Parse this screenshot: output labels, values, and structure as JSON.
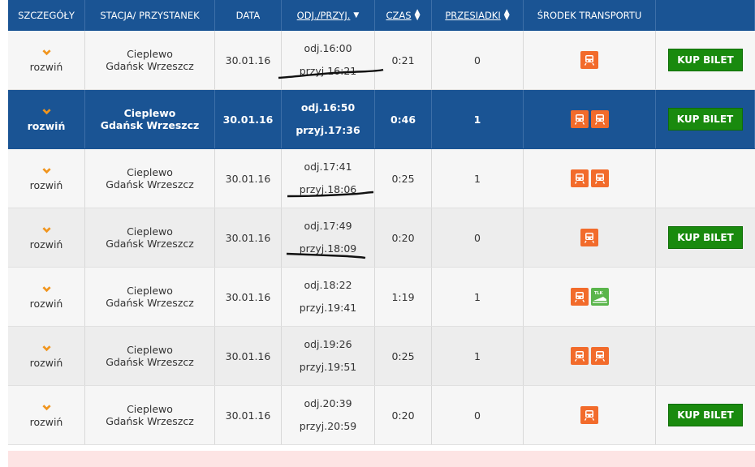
{
  "headers": {
    "details": "SZCZEGÓŁY",
    "station": "STACJA/ PRZYSTANEK",
    "date": "DATA",
    "times": "ODJ./PRZYJ.",
    "duration": "CZAS",
    "transfers": "PRZESIADKI",
    "transport": "ŚRODEK TRANSPORTU"
  },
  "expand_label": "rozwiń",
  "buy_label": "KUP BILET",
  "colors": {
    "header_bg": "#1a5494",
    "accent": "#f0951e",
    "buy_bg": "#198a0e",
    "reg_icon": "#f26b2b",
    "tlk_icon": "#5ab54b"
  },
  "rows": [
    {
      "from": "Cieplewo",
      "to": "Gdańsk Wrzeszcz",
      "date": "30.01.16",
      "dep": "odj.16:00",
      "arr": "przyj.16:21",
      "duration": "0:21",
      "transfers": "0",
      "transport": [
        "reg-icon"
      ],
      "buy": true,
      "selected": false
    },
    {
      "from": "Cieplewo",
      "to": "Gdańsk Wrzeszcz",
      "date": "30.01.16",
      "dep": "odj.16:50",
      "arr": "przyj.17:36",
      "duration": "0:46",
      "transfers": "1",
      "transport": [
        "reg-icon",
        "reg-icon"
      ],
      "buy": true,
      "selected": true
    },
    {
      "from": "Cieplewo",
      "to": "Gdańsk Wrzeszcz",
      "date": "30.01.16",
      "dep": "odj.17:41",
      "arr": "przyj.18:06",
      "duration": "0:25",
      "transfers": "1",
      "transport": [
        "skm-icon",
        "skm-icon"
      ],
      "buy": false,
      "selected": false
    },
    {
      "from": "Cieplewo",
      "to": "Gdańsk Wrzeszcz",
      "date": "30.01.16",
      "dep": "odj.17:49",
      "arr": "przyj.18:09",
      "duration": "0:20",
      "transfers": "0",
      "transport": [
        "reg-icon"
      ],
      "buy": true,
      "selected": false
    },
    {
      "from": "Cieplewo",
      "to": "Gdańsk Wrzeszcz",
      "date": "30.01.16",
      "dep": "odj.18:22",
      "arr": "przyj.19:41",
      "duration": "1:19",
      "transfers": "1",
      "transport": [
        "skm-icon",
        "tlk-icon"
      ],
      "buy": false,
      "selected": false
    },
    {
      "from": "Cieplewo",
      "to": "Gdańsk Wrzeszcz",
      "date": "30.01.16",
      "dep": "odj.19:26",
      "arr": "przyj.19:51",
      "duration": "0:25",
      "transfers": "1",
      "transport": [
        "skm-icon",
        "reg-icon"
      ],
      "buy": false,
      "selected": false
    },
    {
      "from": "Cieplewo",
      "to": "Gdańsk Wrzeszcz",
      "date": "30.01.16",
      "dep": "odj.20:39",
      "arr": "przyj.20:59",
      "duration": "0:20",
      "transfers": "0",
      "transport": [
        "reg-icon"
      ],
      "buy": true,
      "selected": false
    }
  ]
}
